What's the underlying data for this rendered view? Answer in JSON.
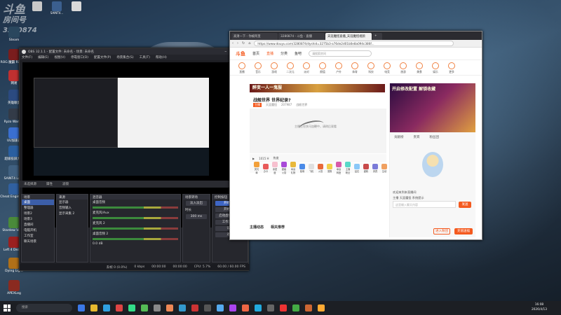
{
  "desktop": {
    "watermark_lines": [
      "斗鱼",
      "房间号",
      "3280874"
    ],
    "icons_top": [
      {
        "label": "",
        "color": "#c9c9c9"
      },
      {
        "label": "SAINT4...",
        "color": "#3b5f8e"
      },
      {
        "label": "",
        "color": "#d9d9d9"
      }
    ],
    "icons_left": [
      {
        "label": "Steam",
        "color": "#2a475e"
      },
      {
        "label": "ROG 魔霸 RX Link",
        "color": "#7a1d1d"
      },
      {
        "label": "网易",
        "color": "#c03030"
      },
      {
        "label": "英雄联盟",
        "color": "#2b4a80"
      },
      {
        "label": "Ryzo Warrior",
        "color": "#333b48"
      },
      {
        "label": "UU加速器",
        "color": "#3a6fd0"
      },
      {
        "label": "超级投屏大师",
        "color": "#2a5fa0"
      },
      {
        "label": "SAINT4 Laun",
        "color": "#406080"
      },
      {
        "label": "Cheat Engine.exe",
        "color": "#3060a0"
      },
      {
        "label": "Stardew Valley",
        "color": "#4a8a3a"
      },
      {
        "label": "Left 4 Dead 2",
        "color": "#9a2020"
      },
      {
        "label": "Dying Light",
        "color": "#b07018"
      },
      {
        "label": "APEXLeg",
        "color": "#8a2a20"
      }
    ]
  },
  "obs": {
    "title": "OBS 32.1.1 - 配置文件: 未命名 - 场景: 未命名",
    "menu": [
      "文件(F)",
      "编辑(E)",
      "视图(V)",
      "停靠窗口(D)",
      "配置文件(P)",
      "场景集合(S)",
      "工具(T)",
      "帮助(H)"
    ],
    "source_bar": [
      "未选择源",
      "属性",
      "滤镜"
    ],
    "docks": {
      "scenes": {
        "title": "场景",
        "items": [
          "桌面",
          "整理器",
          "场景2",
          "场景3",
          "直播间",
          "电脑开机",
          "工作室",
          "聊天场景"
        ],
        "selected": 0
      },
      "sources": {
        "title": "来源",
        "items": [
          "显示器",
          "音频输入",
          "显示采集 2"
        ]
      },
      "mixer": {
        "title": "混音器",
        "channels": [
          "桌面音频",
          "麦克风/Aux",
          "麦克风 2",
          "桌面音频 2"
        ],
        "level_db": "0.0 dB"
      },
      "transitions": {
        "title": "场景转场",
        "type": "淡入淡出",
        "duration_label": "时长",
        "duration": "300 ms"
      },
      "controls": {
        "title": "控制按钮",
        "buttons": [
          "开始直播",
          "开始录制",
          "启动虚拟摄像机",
          "工作室模式",
          "设置",
          "退出"
        ]
      }
    },
    "status": {
      "dropped": "丢帧 0 (0.0%)",
      "bitrate": "0 kbps",
      "time1": "00:00:00",
      "time2": "00:00:00",
      "cpu": "CPU: 5.7%",
      "fps": "60.00 / 60.00 FPS"
    }
  },
  "browser": {
    "tabs": [
      "高清一下 - 你被阿里",
      "3280874 - 斗鱼 - 直播",
      "天涯魔怪直播_天涯魔怪视频",
      ""
    ],
    "url": "https://www.douyu.com/3280874/dyshid=3275b3-a76de2d01b0e8a094c386f...",
    "douyu": {
      "logo": "斗鱼",
      "nav": [
        "首页",
        "直播",
        "分类",
        "鱼吧"
      ],
      "search_placeholder": "请搜索房间",
      "categories": [
        "直播",
        "音乐",
        "游戏",
        "二次元",
        "派对",
        "颜值",
        "户外",
        "体育",
        "科技",
        "电竞",
        "旅游",
        "美食",
        "娱乐",
        "更多"
      ],
      "banner_text": "醉变一人一鬼服",
      "room_title": "战舰世界 世界纪录?",
      "room_tags": [
        "主播",
        "天涯魔怪",
        "207987",
        "战舰世界"
      ],
      "player_message": "主播正在快马加鞭中，请稍后观看",
      "player_info": [
        "1015 H",
        "热度"
      ],
      "gifts": [
        "荧光棒",
        "办卡",
        "亲密度",
        "超级火箭",
        "幸运礼物",
        "航母",
        "飞机",
        "火箭",
        "宠物",
        "幸运转盘",
        "主播粉丝",
        "钻石",
        "超粉",
        "贵宾",
        "互动"
      ],
      "below_tabs": [
        "主播动态",
        "相关推荐"
      ],
      "side": {
        "ad_text": "开启修改配置 解锁收藏",
        "tabs": [
          "贡献榜",
          "贵宾",
          "粉丝团"
        ],
        "chat": [
          "欢迎来到本直播间",
          "主播  天涯魔怪  系统提示",
          "欢迎主播！"
        ],
        "input_placeholder": "这里输入聊天内容",
        "send": "发送",
        "fans_button": "进入粉团",
        "recharge_button": "充值送福"
      }
    }
  },
  "taskbar": {
    "search_placeholder": "搜索",
    "icon_colors": [
      "#3b78e7",
      "#e6b82e",
      "#2fa0e0",
      "#d44",
      "#3d8",
      "#5b5",
      "#888",
      "#e85",
      "#39c",
      "#c33",
      "#555",
      "#5ae",
      "#a4e",
      "#e64",
      "#2ad",
      "#666",
      "#e33",
      "#4a4",
      "#c63",
      "#fa3"
    ],
    "time": "16:08",
    "date": "2026/4/13"
  }
}
